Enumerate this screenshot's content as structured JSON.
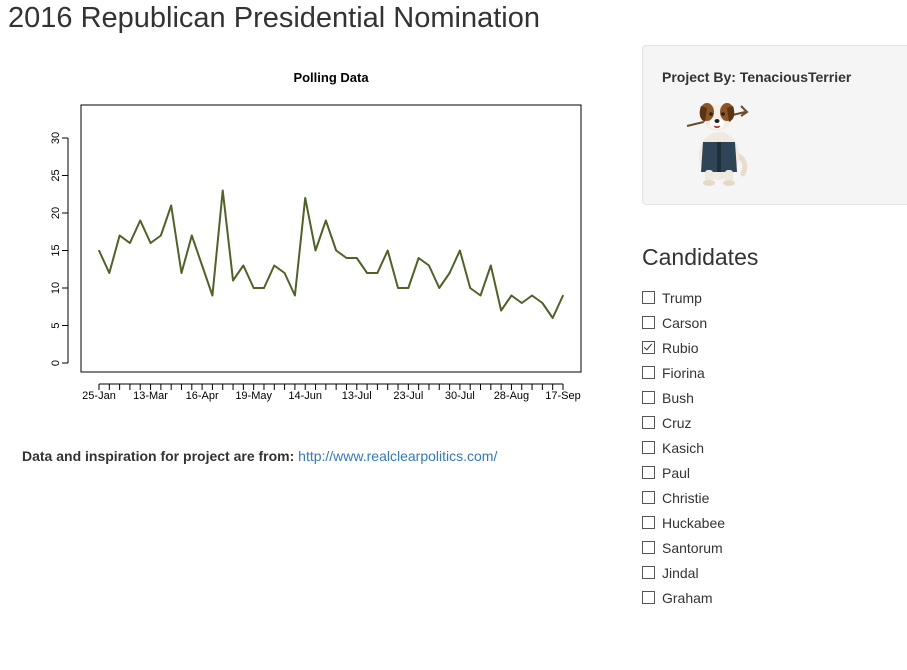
{
  "page": {
    "title": "2016 Republican Presidential Nomination"
  },
  "chart_data": {
    "type": "line",
    "title": "Polling Data",
    "xlabel": "",
    "ylabel": "",
    "ylim": [
      0,
      33
    ],
    "yticks": [
      0,
      5,
      10,
      15,
      20,
      25,
      30
    ],
    "x_tick_labels": [
      "25-Jan",
      "13-Mar",
      "16-Apr",
      "19-May",
      "14-Jun",
      "13-Jul",
      "23-Jul",
      "30-Jul",
      "28-Aug",
      "17-Sep"
    ],
    "grid": false,
    "legend": "none",
    "series": [
      {
        "color": "#4f6228",
        "values": [
          15,
          12,
          17,
          16,
          19,
          16,
          17,
          21,
          12,
          17,
          13,
          9,
          23,
          11,
          13,
          10,
          10,
          13,
          12,
          9,
          22,
          15,
          19,
          15,
          14,
          14,
          12,
          12,
          15,
          10,
          10,
          14,
          13,
          10,
          12,
          15,
          10,
          9,
          13,
          7,
          9,
          8,
          9,
          8,
          6,
          9
        ]
      }
    ]
  },
  "source": {
    "label": "Data and inspiration for project are from:",
    "link_text": "http://www.realclearpolitics.com/",
    "link_href": "http://www.realclearpolitics.com/"
  },
  "author": {
    "label": "Project By: TenaciousTerrier",
    "avatar_icon": "terrier-dog-icon"
  },
  "candidates": {
    "title": "Candidates",
    "items": [
      {
        "name": "Trump",
        "checked": false
      },
      {
        "name": "Carson",
        "checked": false
      },
      {
        "name": "Rubio",
        "checked": true
      },
      {
        "name": "Fiorina",
        "checked": false
      },
      {
        "name": "Bush",
        "checked": false
      },
      {
        "name": "Cruz",
        "checked": false
      },
      {
        "name": "Kasich",
        "checked": false
      },
      {
        "name": "Paul",
        "checked": false
      },
      {
        "name": "Christie",
        "checked": false
      },
      {
        "name": "Huckabee",
        "checked": false
      },
      {
        "name": "Santorum",
        "checked": false
      },
      {
        "name": "Jindal",
        "checked": false
      },
      {
        "name": "Graham",
        "checked": false
      }
    ]
  }
}
